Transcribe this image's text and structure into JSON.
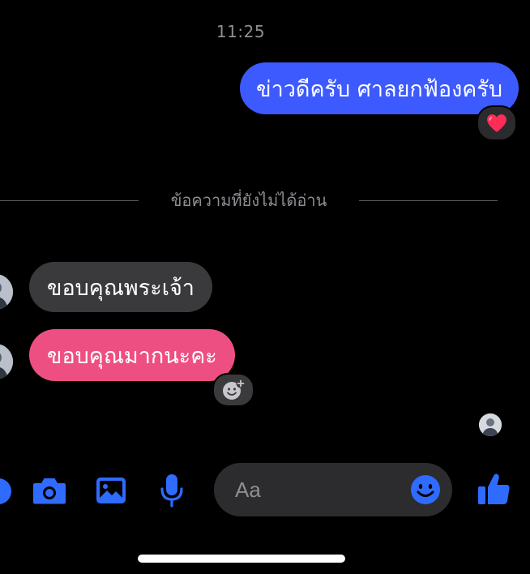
{
  "status": {
    "time": "11:25"
  },
  "messages": {
    "outgoing": [
      {
        "text": "ข่าวดีครับ ศาลยกฟ้องครับ",
        "reaction": "heart"
      }
    ],
    "divider_text": "ข้อความที่ยังไม่ได้อ่าน",
    "incoming": [
      {
        "text": "ขอบคุณพระเจ้า",
        "color": "#3a3a3c"
      },
      {
        "text": "ขอบคุณมากนะคะ",
        "color": "#ee4f82"
      }
    ]
  },
  "composer": {
    "placeholder": "Aa",
    "icons": [
      "more-icon",
      "camera-icon",
      "gallery-icon",
      "microphone-icon",
      "emoji-icon",
      "thumbs-up-icon"
    ]
  },
  "colors": {
    "accent": "#3d5afe",
    "icon_blue": "#2f6bff",
    "incoming_dark": "#3a3a3c",
    "incoming_pink": "#ee4f82",
    "heart": "#ff2d55",
    "background": "#000000"
  }
}
